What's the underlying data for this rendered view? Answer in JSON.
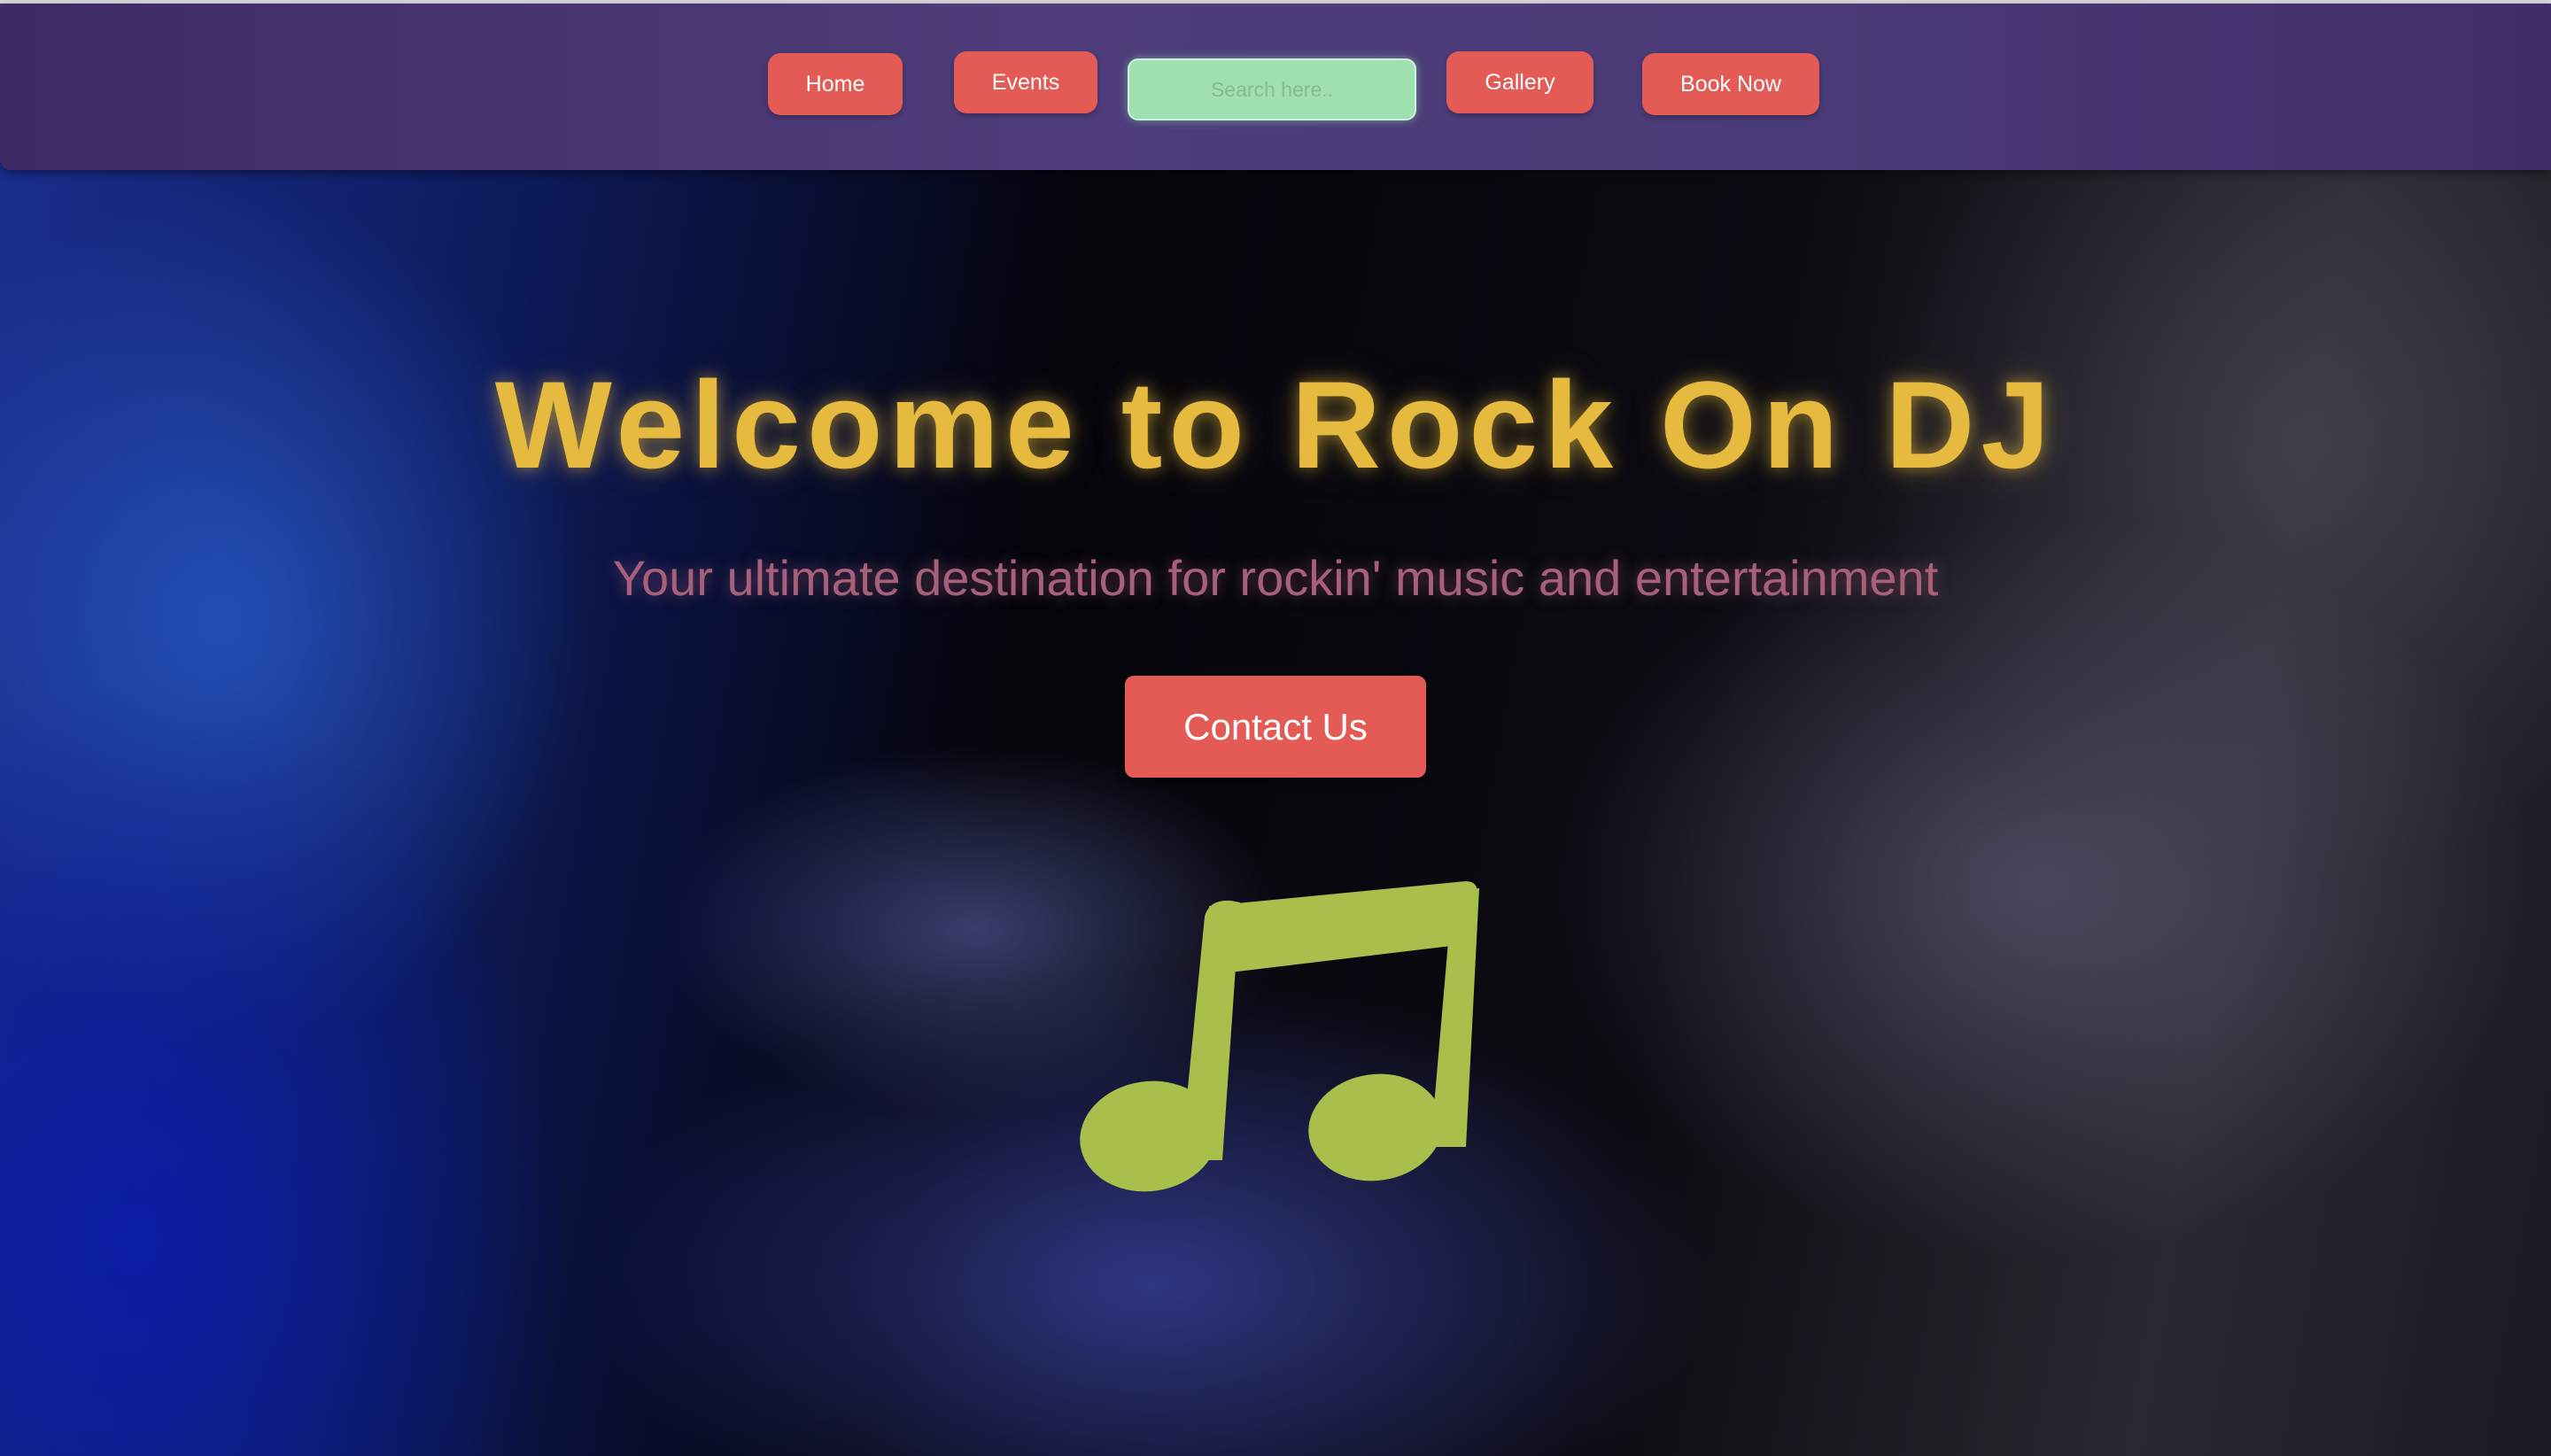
{
  "nav": {
    "home_label": "Home",
    "events_label": "Events",
    "search_placeholder": "Search here..",
    "gallery_label": "Gallery",
    "book_label": "Book Now"
  },
  "hero": {
    "title": "Welcome to Rock On DJ",
    "subtitle": "Your ultimate destination for rockin' music and entertainment",
    "contact_label": "Contact Us",
    "icon": "music-note-icon"
  },
  "colors": {
    "nav_background": "#4a3b78",
    "button": "#e45a55",
    "search_field": "#9fdfb0",
    "title": "#e6b93f",
    "subtitle": "#a7607a",
    "music_note": "#a8bf4c"
  }
}
